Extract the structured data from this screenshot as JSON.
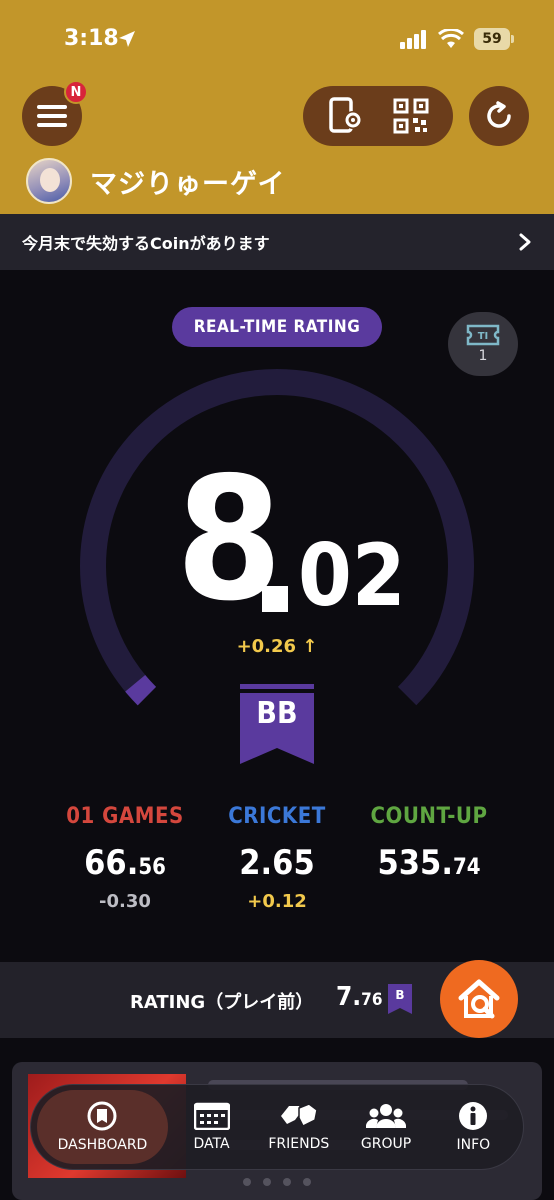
{
  "status_bar": {
    "time": "3:18",
    "battery": "59"
  },
  "header": {
    "menu_badge": "N",
    "username": "マジりゅーゲイ"
  },
  "notice": {
    "text": "今月末で失効するCoinがあります"
  },
  "rating": {
    "pill_label": "REAL-TIME RATING",
    "ticket_count": "1",
    "integer": "8",
    "decimal": "02",
    "delta": "+0.26 ↑",
    "class": "BB",
    "gauge_fraction": 0.02
  },
  "stats": [
    {
      "label": "01 GAMES",
      "value_int": "66.",
      "value_dec": "56",
      "delta": "-0.30",
      "color": "#d4473d",
      "delta_color": "#bdbdc4"
    },
    {
      "label": "CRICKET",
      "value_int": "2.65",
      "value_dec": "",
      "delta": "+0.12",
      "color": "#3b78d8",
      "delta_color": "#f2c94c"
    },
    {
      "label": "COUNT-UP",
      "value_int": "535.",
      "value_dec": "74",
      "delta": "",
      "color": "#5fa641",
      "delta_color": "#bdbdc4"
    }
  ],
  "rating_bar": {
    "label": "RATING（プレイ前）",
    "value_int": "7.",
    "value_dec": "76",
    "badge": "B"
  },
  "nav": {
    "items": [
      {
        "label": "DASHBOARD",
        "icon": "dashboard-icon"
      },
      {
        "label": "DATA",
        "icon": "calendar-icon"
      },
      {
        "label": "FRIENDS",
        "icon": "friends-icon"
      },
      {
        "label": "GROUP",
        "icon": "group-icon"
      },
      {
        "label": "INFO",
        "icon": "info-icon"
      }
    ]
  },
  "colors": {
    "accent": "#c2962a",
    "purple": "#5a3a9e",
    "gauge_track": "#221c3c",
    "orange": "#ef6a20"
  }
}
